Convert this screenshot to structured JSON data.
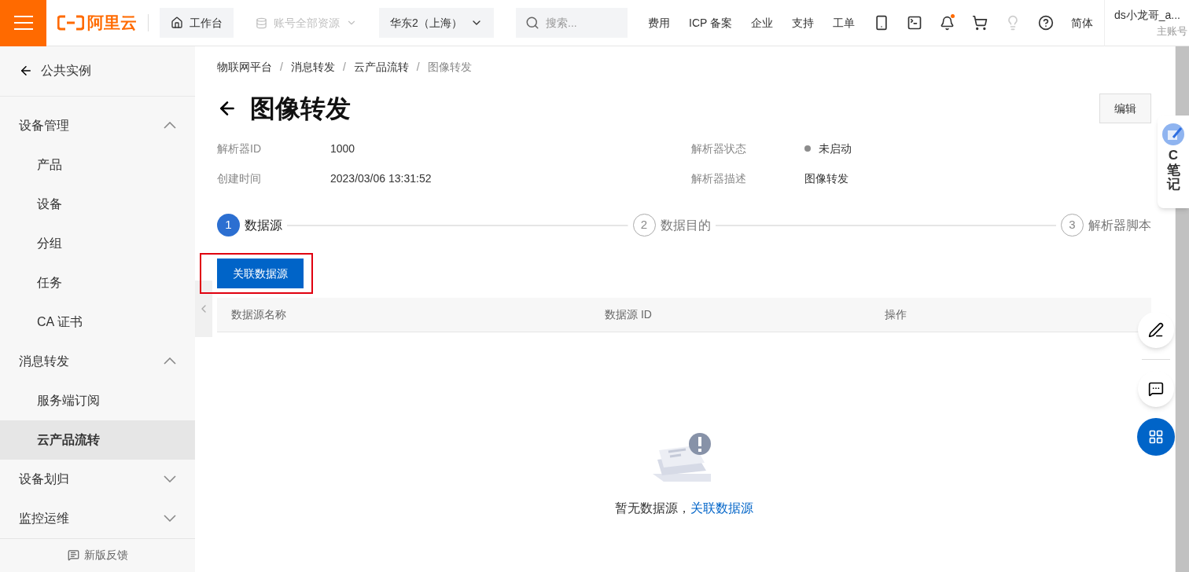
{
  "topbar": {
    "logo": "阿里云",
    "workbench": "工作台",
    "resources": {
      "label": "账号全部资源",
      "disabled": true
    },
    "region": "华东2（上海）",
    "search": {
      "placeholder": "搜索..."
    },
    "links": [
      "费用",
      "ICP 备案",
      "企业",
      "支持",
      "工单"
    ],
    "notification_dot": true,
    "language": "简体",
    "user": {
      "name": "ds小龙哥_a...",
      "role": "主账号"
    }
  },
  "sidebar": {
    "back": "公共实例",
    "groups": [
      {
        "label": "设备管理",
        "expanded": true,
        "children": [
          {
            "label": "产品",
            "selected": false
          },
          {
            "label": "设备",
            "selected": false
          },
          {
            "label": "分组",
            "selected": false
          },
          {
            "label": "任务",
            "selected": false
          },
          {
            "label": "CA 证书",
            "selected": false
          }
        ]
      },
      {
        "label": "消息转发",
        "expanded": true,
        "children": [
          {
            "label": "服务端订阅",
            "selected": false
          },
          {
            "label": "云产品流转",
            "selected": true
          }
        ]
      },
      {
        "label": "设备划归",
        "expanded": false
      },
      {
        "label": "监控运维",
        "expanded": false
      }
    ],
    "feedback": "新版反馈"
  },
  "breadcrumb": {
    "separator": "/",
    "items": [
      "物联网平台",
      "消息转发",
      "云产品流转",
      "图像转发"
    ]
  },
  "title": "图像转发",
  "edit_button": "编辑",
  "fields": [
    {
      "label": "解析器ID",
      "value": "1000"
    },
    {
      "label": "解析器状态",
      "value": "未启动",
      "color": "#8c8c8c"
    },
    {
      "label": "创建时间",
      "value": "2023/03/06 13:31:52"
    },
    {
      "label": "解析器描述",
      "value": "图像转发"
    }
  ],
  "steps": [
    {
      "number": "1",
      "label": "数据源",
      "selected": true
    },
    {
      "number": "2",
      "label": "数据目的",
      "selected": false
    },
    {
      "number": "3",
      "label": "解析器脚本",
      "selected": false
    }
  ],
  "primary_button": {
    "label": "关联数据源",
    "highlighted": true
  },
  "table": {
    "columns": [
      "数据源名称",
      "数据源 ID",
      "操作"
    ]
  },
  "empty": {
    "text": "暂无数据源，",
    "link": "关联数据源"
  },
  "note_tab": {
    "letter": "C",
    "label": "笔记"
  }
}
